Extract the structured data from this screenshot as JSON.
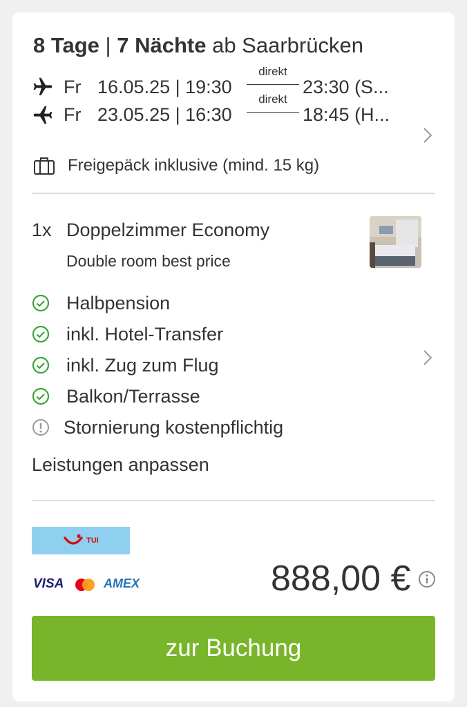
{
  "trip": {
    "duration_days": "8 Tage",
    "separator": "|",
    "duration_nights": "7 Nächte",
    "departure_from": "ab Saarbrücken"
  },
  "flights": [
    {
      "direction": "outbound",
      "icon": "plane-outbound-icon",
      "day": "Fr",
      "date_time": "16.05.25 | 19:30",
      "connection": "direkt",
      "arrival": "23:30 (S..."
    },
    {
      "direction": "return",
      "icon": "plane-return-icon",
      "day": "Fr",
      "date_time": "23.05.25 | 16:30",
      "connection": "direkt",
      "arrival": "18:45 (H..."
    }
  ],
  "luggage": {
    "icon": "luggage-icon",
    "text": "Freigepäck inklusive (mind. 15 kg)"
  },
  "room": {
    "quantity": "1x",
    "name": "Doppelzimmer Economy",
    "subtitle": "Double room best price"
  },
  "features": [
    {
      "icon": "check-circle-icon",
      "text": "Halbpension"
    },
    {
      "icon": "check-circle-icon",
      "text": "inkl. Hotel-Transfer"
    },
    {
      "icon": "check-circle-icon",
      "text": "inkl. Zug zum Flug"
    },
    {
      "icon": "check-circle-icon",
      "text": "Balkon/Terrasse"
    },
    {
      "icon": "exclamation-circle-icon",
      "text": "Stornierung kostenpflichtig"
    }
  ],
  "customize_link": "Leistungen anpassen",
  "operator": {
    "name": "TUI",
    "logo_bg": "#8fd0f0",
    "logo_color": "#d40e14"
  },
  "payment_methods": {
    "visa": "VISA",
    "amex": "AMEX"
  },
  "price": "888,00 €",
  "cta": "zur Buchung",
  "colors": {
    "accent_green": "#79b52a",
    "check_green": "#3aa536",
    "text": "#333333"
  }
}
